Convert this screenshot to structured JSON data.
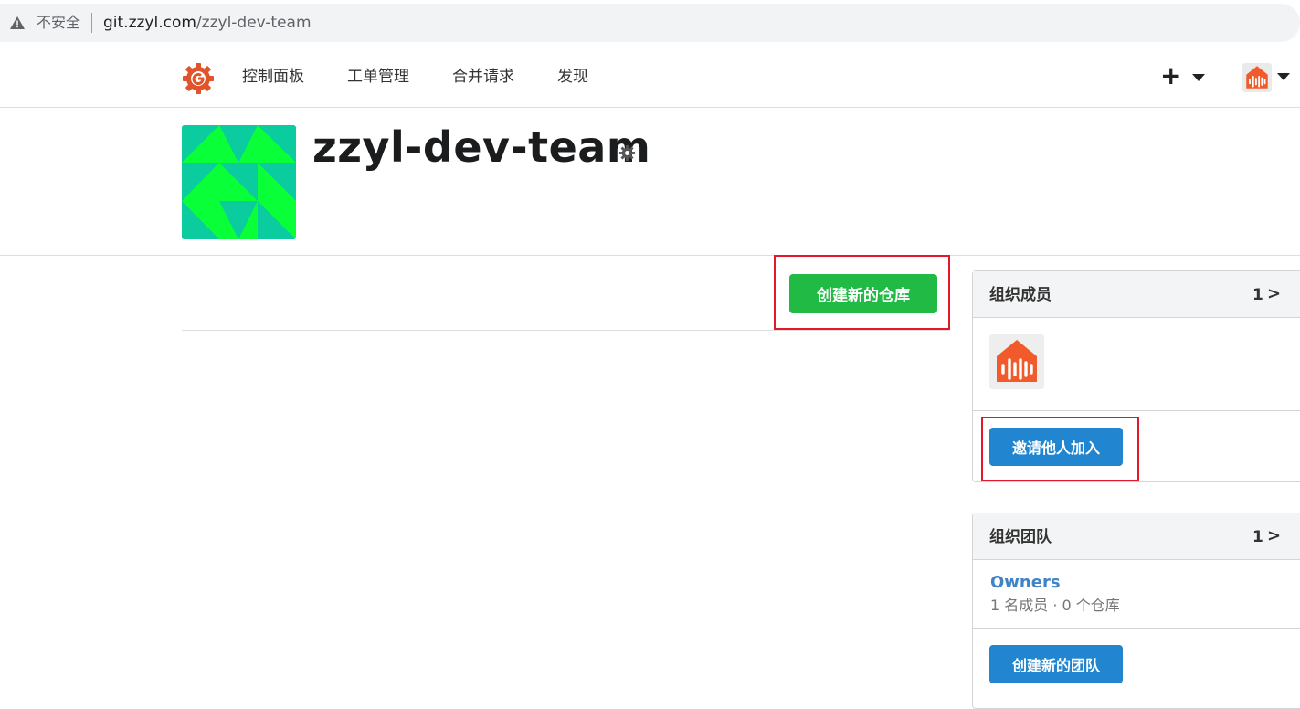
{
  "browser": {
    "security_label": "不安全",
    "url_host": "git.zzyl.com",
    "url_path": "/zzyl-dev-team"
  },
  "nav": {
    "items": [
      "控制面板",
      "工单管理",
      "合并请求",
      "发现"
    ],
    "plus": "+"
  },
  "org": {
    "name": "zzyl-dev-team"
  },
  "main": {
    "create_repo_label": "创建新的仓库"
  },
  "members_panel": {
    "title": "组织成员",
    "count": "1",
    "chevron": ">",
    "invite_label": "邀请他人加入"
  },
  "teams_panel": {
    "title": "组织团队",
    "count": "1",
    "chevron": ">",
    "team_name": "Owners",
    "team_meta": "1 名成员 · 0 个仓库",
    "create_team_label": "创建新的团队"
  },
  "colors": {
    "create_repo": "#21ba45",
    "primary": "#2185d0",
    "link": "#4183c4",
    "highlight_box": "#e3192b",
    "gitea_logo": "#e0542c",
    "avatar_orange": "#f15a2b",
    "org_avatar_green": "#09ff37",
    "org_avatar_teal": "#0bcc9e"
  }
}
